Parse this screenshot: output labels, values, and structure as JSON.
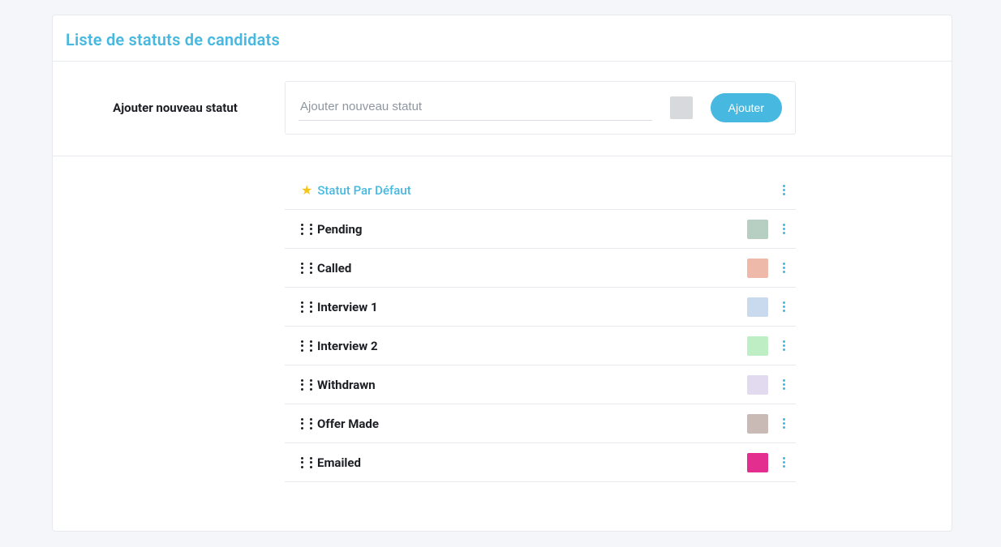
{
  "header": {
    "title": "Liste de statuts de candidats"
  },
  "add": {
    "label": "Ajouter nouveau statut",
    "placeholder": "Ajouter nouveau statut",
    "button_label": "Ajouter",
    "swatch_color": "#d7d9dd"
  },
  "default_status": {
    "label": "Statut Par Défaut",
    "icon": "star-icon"
  },
  "statuses": [
    {
      "label": "Pending",
      "color": "#b7cec3"
    },
    {
      "label": "Called",
      "color": "#efb9a9"
    },
    {
      "label": "Interview 1",
      "color": "#c9daee"
    },
    {
      "label": "Interview 2",
      "color": "#bdeec4"
    },
    {
      "label": "Withdrawn",
      "color": "#e2dbef"
    },
    {
      "label": "Offer Made",
      "color": "#cabab5"
    },
    {
      "label": "Emailed",
      "color": "#e32d8f"
    }
  ]
}
